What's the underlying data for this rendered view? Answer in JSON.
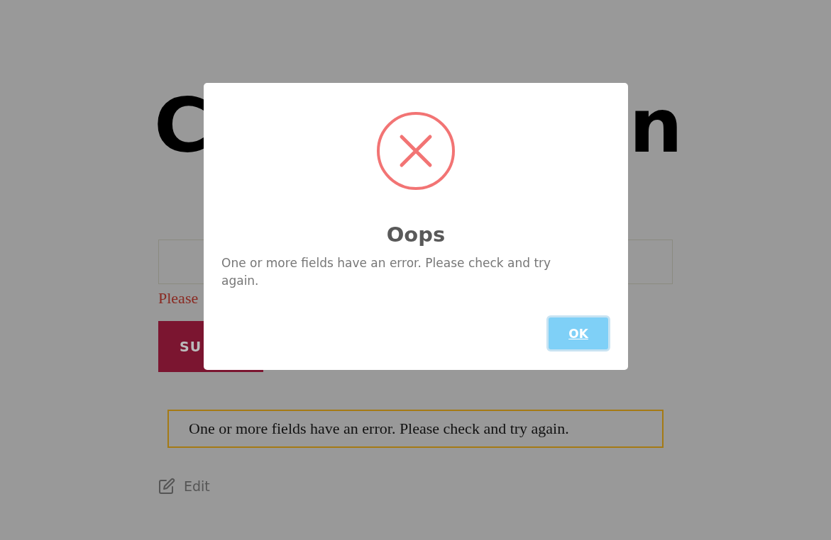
{
  "page": {
    "heading_left": "C",
    "heading_right": "n",
    "field_error": "Please",
    "submit_button": "SU",
    "form_message": "One or more fields have an error. Please check and try again.",
    "edit_link": "Edit"
  },
  "dialog": {
    "title": "Oops",
    "message": "One or more fields have an error. Please check and try again.",
    "button": "OK"
  }
}
